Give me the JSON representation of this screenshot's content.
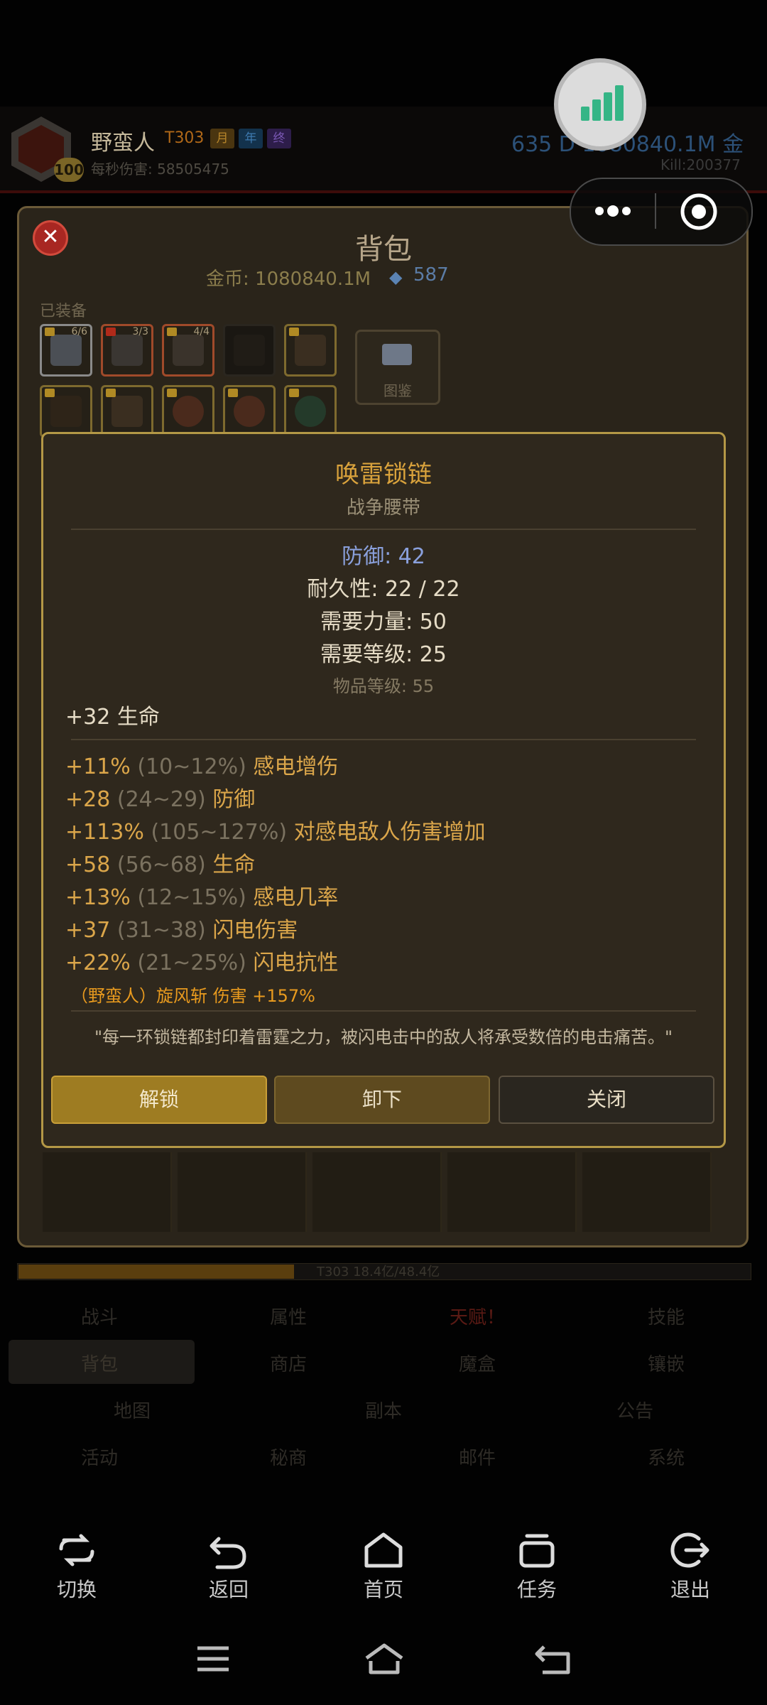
{
  "header": {
    "class_name": "野蛮人",
    "tier": "T303",
    "tags": [
      "月",
      "年",
      "终"
    ],
    "level": "100",
    "dps": "每秒伤害: 58505475",
    "gold": "635 D  1080840.1M 金",
    "kills": "Kill:200377"
  },
  "bag": {
    "title": "背包",
    "gold": "金币: 1080840.1M",
    "gems": "587",
    "equipped_label": "已装备",
    "slot_counts": [
      "6/6",
      "3/3",
      "4/4"
    ],
    "codex_label": "图鉴",
    "xp_text": "T303  18.4亿/48.4亿"
  },
  "item": {
    "name": "唤雷锁链",
    "type": "战争腰带",
    "defense": "防御: 42",
    "durability": "耐久性: 22 / 22",
    "req_str": "需要力量: 50",
    "req_level": "需要等级: 25",
    "item_level": "物品等级: 55",
    "implicit": "+32 生命",
    "affixes": [
      {
        "value": "+11%",
        "range": "(10~12%)",
        "stat": "感电增伤"
      },
      {
        "value": "+28",
        "range": "(24~29)",
        "stat": "防御"
      },
      {
        "value": "+113%",
        "range": "(105~127%)",
        "stat": "对感电敌人伤害增加"
      },
      {
        "value": "+58",
        "range": "(56~68)",
        "stat": "生命"
      },
      {
        "value": "+13%",
        "range": "(12~15%)",
        "stat": "感电几率"
      },
      {
        "value": "+37",
        "range": "(31~38)",
        "stat": "闪电伤害"
      },
      {
        "value": "+22%",
        "range": "(21~25%)",
        "stat": "闪电抗性"
      }
    ],
    "skill_bonus": "（野蛮人）旋风斩 伤害 +157%",
    "flavor": "\"每一环锁链都封印着雷霆之力，被闪电击中的敌人将承受数倍的电击痛苦。\"",
    "buttons": {
      "unlock": "解锁",
      "unequip": "卸下",
      "close": "关闭"
    }
  },
  "game_nav": {
    "row1": [
      "战斗",
      "属性",
      "天赋！",
      "技能"
    ],
    "row2": [
      "背包",
      "商店",
      "魔盒",
      "镶嵌"
    ],
    "row3": [
      "地图",
      "副本",
      "公告"
    ],
    "row4": [
      "活动",
      "秘商",
      "邮件",
      "系统"
    ]
  },
  "system_nav": [
    "切换",
    "返回",
    "首页",
    "任务",
    "退出"
  ],
  "colors": {
    "accent_gold": "#d9a23c",
    "affix": "#dba64a",
    "defense_blue": "#8aa0dc",
    "talent_red": "#5a1a14"
  }
}
